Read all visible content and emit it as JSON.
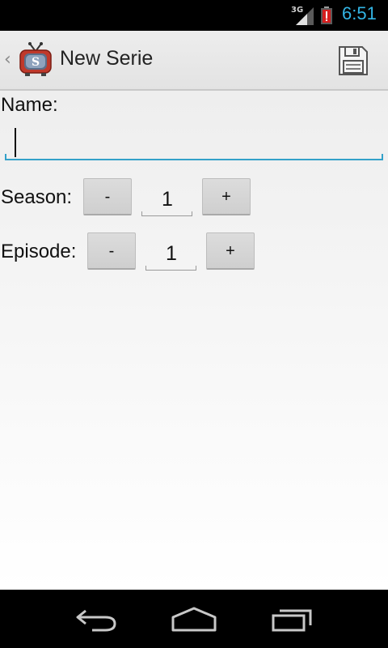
{
  "status_bar": {
    "network_type": "3G",
    "time": "6:51"
  },
  "action_bar": {
    "title": "New Serie",
    "app_icon_letter": "S"
  },
  "form": {
    "name_label": "Name:",
    "name_value": "",
    "season": {
      "label": "Season:",
      "minus_label": "-",
      "value": "1",
      "plus_label": "+"
    },
    "episode": {
      "label": "Episode:",
      "minus_label": "-",
      "value": "1",
      "plus_label": "+"
    }
  },
  "colors": {
    "accent": "#33b5e5",
    "input_focus": "#33a1c9",
    "battery_alert": "#d61f1f"
  }
}
